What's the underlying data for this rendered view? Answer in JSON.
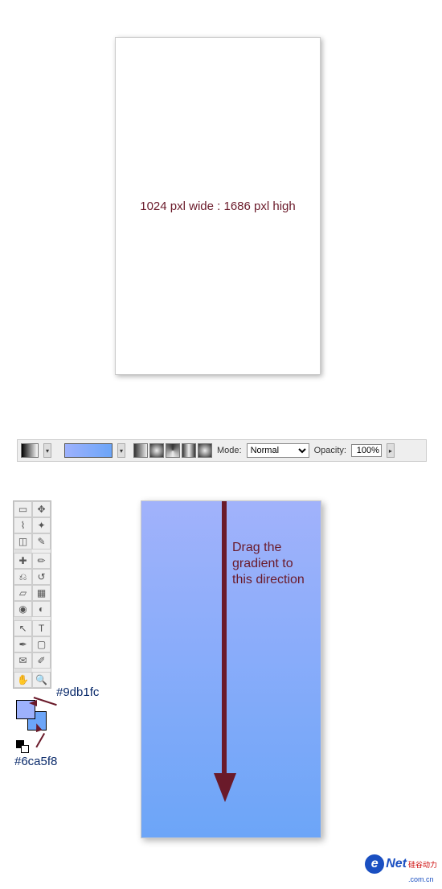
{
  "canvas_blank_label": "1024 pxl wide : 1686 pxl high",
  "options_bar": {
    "mode_label": "Mode:",
    "mode_value": "Normal",
    "opacity_label": "Opacity:",
    "opacity_value": "100%"
  },
  "tools": [
    {
      "n": "marquee-icon",
      "g": "▭"
    },
    {
      "n": "move-icon",
      "g": "✥"
    },
    {
      "n": "lasso-icon",
      "g": "⌇"
    },
    {
      "n": "wand-icon",
      "g": "✦"
    },
    {
      "n": "crop-icon",
      "g": "◫"
    },
    {
      "n": "slice-icon",
      "g": "✎"
    },
    {
      "n": "heal-icon",
      "g": "✚"
    },
    {
      "n": "brush-icon",
      "g": "✏"
    },
    {
      "n": "stamp-icon",
      "g": "⎌"
    },
    {
      "n": "history-icon",
      "g": "↺"
    },
    {
      "n": "eraser-icon",
      "g": "▱"
    },
    {
      "n": "gradient-icon",
      "g": "▦"
    },
    {
      "n": "blur-icon",
      "g": "◉"
    },
    {
      "n": "dodge-icon",
      "g": "◐"
    },
    {
      "n": "path-icon",
      "g": "↖"
    },
    {
      "n": "type-icon",
      "g": "T"
    },
    {
      "n": "pen-icon",
      "g": "✒"
    },
    {
      "n": "shape-icon",
      "g": "▢"
    },
    {
      "n": "note-icon",
      "g": "✉"
    },
    {
      "n": "eyedrop-icon",
      "g": "✐"
    },
    {
      "n": "hand-icon",
      "g": "✋"
    },
    {
      "n": "zoom-icon",
      "g": "🔍"
    }
  ],
  "swatch_fg_hex": "#9db1fc",
  "swatch_bg_hex": "#6ca5f8",
  "drag_text": "Drag the gradient to this direction",
  "logo": {
    "e": "e",
    "net": "Net",
    "cn1": "硅谷动力",
    "cn2": ".com.cn"
  }
}
